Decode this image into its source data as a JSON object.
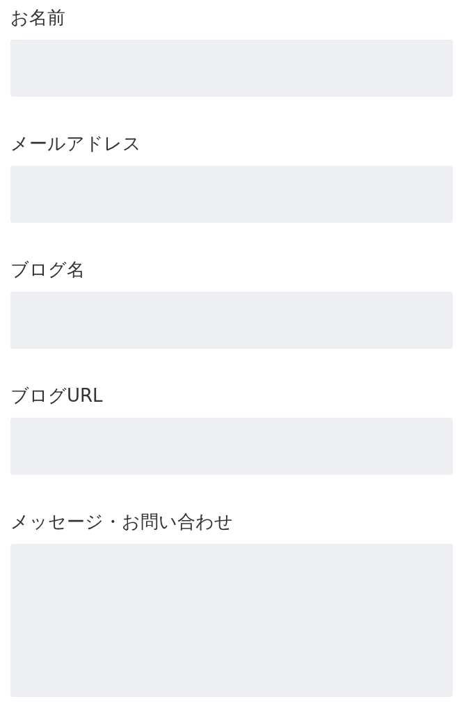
{
  "form": {
    "fields": [
      {
        "label": "お名前",
        "kind": "text"
      },
      {
        "label": "メールアドレス",
        "kind": "text"
      },
      {
        "label": "ブログ名",
        "kind": "text"
      },
      {
        "label": "ブログURL",
        "kind": "text"
      },
      {
        "label": "メッセージ・お問い合わせ",
        "kind": "textarea"
      }
    ]
  }
}
